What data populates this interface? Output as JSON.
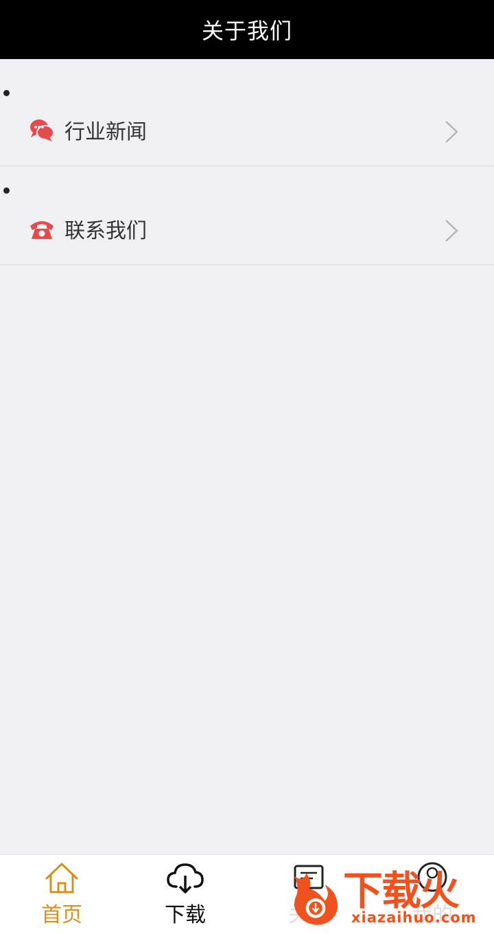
{
  "header": {
    "title": "关于我们"
  },
  "menu": {
    "items": [
      {
        "label": "行业新闻",
        "icon": "chat-bubbles-icon"
      },
      {
        "label": "联系我们",
        "icon": "telephone-icon"
      }
    ]
  },
  "tabbar": {
    "tabs": [
      {
        "label": "首页",
        "icon": "home-icon",
        "active": true
      },
      {
        "label": "下载",
        "icon": "cloud-download-icon",
        "active": false
      },
      {
        "label": "关于",
        "icon": "card-icon",
        "active": false
      },
      {
        "label": "我的",
        "icon": "user-icon",
        "active": false
      }
    ]
  },
  "watermark": {
    "text": "下载火",
    "sub": "xiazaihuo.com"
  },
  "colors": {
    "header_bg": "#000000",
    "active_tab": "#d8901c",
    "icon_red": "#e54b4b",
    "watermark": "#f0521f"
  }
}
